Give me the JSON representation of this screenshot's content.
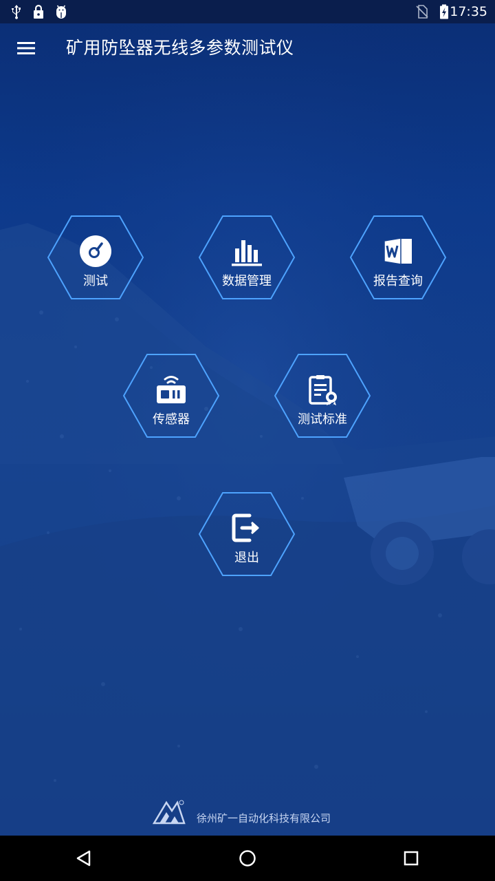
{
  "status_bar": {
    "time": "17:35",
    "icons": [
      "usb-icon",
      "lock-icon",
      "android-debug-icon",
      "no-sim-icon",
      "battery-charging-icon"
    ]
  },
  "app_bar": {
    "title": "矿用防坠器无线多参数测试仪",
    "menu_icon": "hamburger-menu-icon"
  },
  "menu": {
    "items": [
      {
        "label": "测试",
        "icon": "gauge-icon"
      },
      {
        "label": "数据管理",
        "icon": "bar-chart-icon"
      },
      {
        "label": "报告查询",
        "icon": "word-document-icon"
      },
      {
        "label": "传感器",
        "icon": "sensor-radio-icon"
      },
      {
        "label": "测试标准",
        "icon": "certificate-document-icon"
      },
      {
        "label": "退出",
        "icon": "exit-icon"
      }
    ]
  },
  "footer": {
    "company": "徐州矿一自动化科技有限公司",
    "logo_icon": "company-logo-icon"
  },
  "colors": {
    "hex_border": "#4ea3ff",
    "background": "#123f8e",
    "status_bar": "#0a1e4d"
  },
  "nav_bar": {
    "icons": [
      "back-icon",
      "home-icon",
      "recents-icon"
    ]
  }
}
